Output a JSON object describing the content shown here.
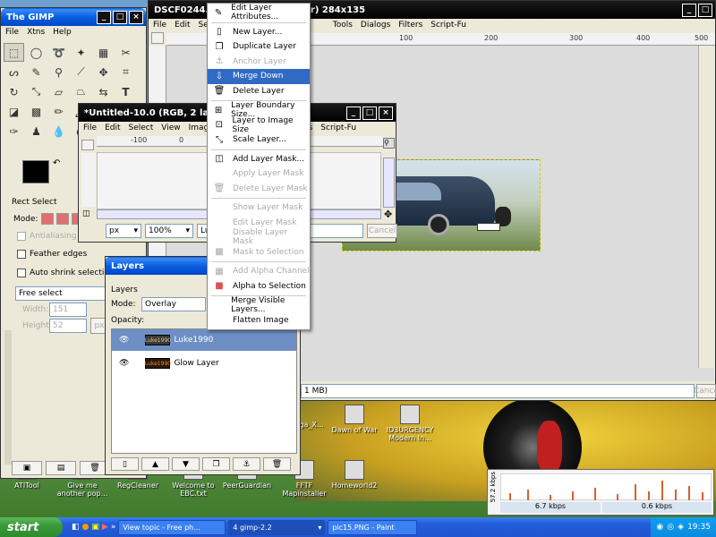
{
  "main_image_window": {
    "title": "DSCF0244.JPG-1.0 (RGB, 1 layer) 284x135",
    "menu": [
      "File",
      "Edit",
      "Se",
      "Tools",
      "Dialogs",
      "Filters",
      "Script-Fu"
    ],
    "ruler_ticks": [
      "100",
      "200",
      "300",
      "400",
      "500"
    ],
    "status_text": "1 MB)",
    "cancel_label": "Cance"
  },
  "toolbox": {
    "title": "The GIMP",
    "menu": [
      "File",
      "Xtns",
      "Help"
    ],
    "tool_icons": [
      "rect-select",
      "ellipse-select",
      "lasso",
      "fuzzy-select",
      "color-select",
      "scissors",
      "paths",
      "color-picker",
      "zoom",
      "measure",
      "move",
      "crop",
      "rotate",
      "scale",
      "shear",
      "perspective",
      "flip",
      "text",
      "bucket-fill",
      "blend",
      "pencil",
      "paintbrush",
      "eraser",
      "airbrush",
      "ink",
      "clone",
      "blur",
      "dodge"
    ],
    "section_label": "Rect Select",
    "mode_label": "Mode:",
    "antialiasing_label": "Antialiasing",
    "feather_label": "Feather edges",
    "auto_shrink_label": "Auto shrink selection",
    "select_value": "Free select",
    "width_label": "Width:",
    "width_value": "151",
    "height_label": "Height:",
    "height_value": "52",
    "px_label": "px"
  },
  "untitled_window": {
    "title": "*Untitled-10.0 (RGB, 2 lay",
    "menu": [
      "File",
      "Edit",
      "Select",
      "View",
      "Image"
    ],
    "menu_right": [
      "ters",
      "Script-Fu"
    ],
    "ruler_ticks": [
      "-100",
      "0",
      "100"
    ],
    "unit": "px",
    "zoom": "100%",
    "layer_field": "Luk",
    "cancel_label": "Cancel"
  },
  "layers_dialog": {
    "title": "Layers",
    "section_label": "Layers",
    "mode_label": "Mode:",
    "mode_value": "Overlay",
    "opacity_label": "Opacity:",
    "layers": [
      {
        "name": "Luke1990",
        "selected": true,
        "thumb_text": "Luke1990"
      },
      {
        "name": "Glow Layer",
        "selected": false,
        "thumb_text": "Luke1990"
      }
    ]
  },
  "context_menu": {
    "items": [
      {
        "label": "Edit Layer Attributes...",
        "icon": "edit-layer-icon",
        "disabled": false,
        "highlight": false
      },
      {
        "sep": true
      },
      {
        "label": "New Layer...",
        "icon": "new-layer-icon",
        "disabled": false,
        "highlight": false
      },
      {
        "label": "Duplicate Layer",
        "icon": "duplicate-layer-icon",
        "disabled": false,
        "highlight": false
      },
      {
        "label": "Anchor Layer",
        "icon": "anchor-icon",
        "disabled": true,
        "highlight": false
      },
      {
        "label": "Merge Down",
        "icon": "merge-down-icon",
        "disabled": false,
        "highlight": true
      },
      {
        "label": "Delete Layer",
        "icon": "delete-layer-icon",
        "disabled": false,
        "highlight": false
      },
      {
        "sep": true
      },
      {
        "label": "Layer Boundary Size...",
        "icon": "boundary-size-icon",
        "disabled": false,
        "highlight": false
      },
      {
        "label": "Layer to Image Size",
        "icon": "layer-to-image-icon",
        "disabled": false,
        "highlight": false
      },
      {
        "label": "Scale Layer...",
        "icon": "scale-layer-icon",
        "disabled": false,
        "highlight": false
      },
      {
        "sep": true
      },
      {
        "label": "Add Layer Mask...",
        "icon": "add-mask-icon",
        "disabled": false,
        "highlight": false
      },
      {
        "label": "Apply Layer Mask",
        "icon": "",
        "disabled": true,
        "highlight": false
      },
      {
        "label": "Delete Layer Mask",
        "icon": "delete-mask-icon",
        "disabled": true,
        "highlight": false
      },
      {
        "sep": true
      },
      {
        "label": "Show Layer Mask",
        "icon": "",
        "disabled": true,
        "highlight": false
      },
      {
        "label": "Edit Layer Mask",
        "icon": "",
        "disabled": true,
        "highlight": false
      },
      {
        "label": "Disable Layer Mask",
        "icon": "",
        "disabled": true,
        "highlight": false
      },
      {
        "label": "Mask to Selection",
        "icon": "mask-selection-icon",
        "disabled": true,
        "highlight": false
      },
      {
        "sep": true
      },
      {
        "label": "Add Alpha Channel",
        "icon": "alpha-channel-icon",
        "disabled": true,
        "highlight": false
      },
      {
        "label": "Alpha to Selection",
        "icon": "alpha-selection-icon",
        "disabled": false,
        "highlight": false
      },
      {
        "sep": true
      },
      {
        "label": "Merge Visible Layers...",
        "icon": "",
        "disabled": false,
        "highlight": false
      },
      {
        "label": "Flatten Image",
        "icon": "",
        "disabled": false,
        "highlight": false
      }
    ]
  },
  "desktop_icons": [
    {
      "label": "ATITool"
    },
    {
      "label": "Give me another pop..."
    },
    {
      "label": "RegCleaner"
    },
    {
      "label": "Welcome to EBC.txt"
    },
    {
      "label": "PeerGuardian"
    },
    {
      "label": "FFTF Mapinstaller"
    },
    {
      "label": "Homeworld2"
    },
    {
      "label": "Dawn of War"
    },
    {
      "label": "ID3URGENCY Modern In..."
    },
    {
      "label": "ga_X..."
    }
  ],
  "network_monitor": {
    "y_label": "57.2 kbps",
    "left_value": "6.7 kbps",
    "right_value": "0.6 kbps"
  },
  "taskbar": {
    "start_label": "start",
    "tasks": [
      "View topic - Free ph...",
      "4 gimp-2.2",
      "pic15.PNG - Paint"
    ],
    "clock": "19:35"
  }
}
